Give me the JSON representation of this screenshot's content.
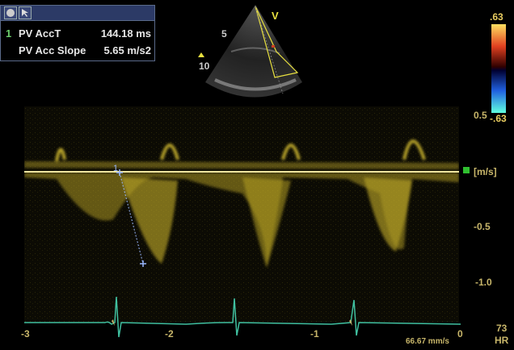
{
  "toolbar": {
    "icons": [
      "record-icon",
      "cursor-icon"
    ]
  },
  "measurements": [
    {
      "index": "1",
      "label": "PV AccT",
      "value": "144.18 ms"
    },
    {
      "index": "",
      "label": "PV Acc Slope",
      "value": "5.65 m/s2"
    }
  ],
  "sector": {
    "view_marker": "V",
    "depth_5": "5",
    "depth_10": "10"
  },
  "colorbar": {
    "top": ".63",
    "bottom": "-.63"
  },
  "velocity_axis": {
    "v_pos": "0.5",
    "unit": "[m/s]",
    "v_neg05": "-0.5",
    "v_neg10": "-1.0"
  },
  "time_axis": {
    "t_neg3": "-3",
    "t_neg2": "-2",
    "t_neg1": "-1",
    "t_0": "0"
  },
  "sweep_speed": "66.67 mm/s",
  "heart_rate": {
    "value": "73",
    "unit": "HR"
  },
  "caliper": {
    "marker": "1"
  },
  "colors": {
    "doppler": "#d8c030",
    "ecg": "#40c0a0",
    "caliper": "#8ab0ff",
    "accent": "#e8cc60"
  }
}
